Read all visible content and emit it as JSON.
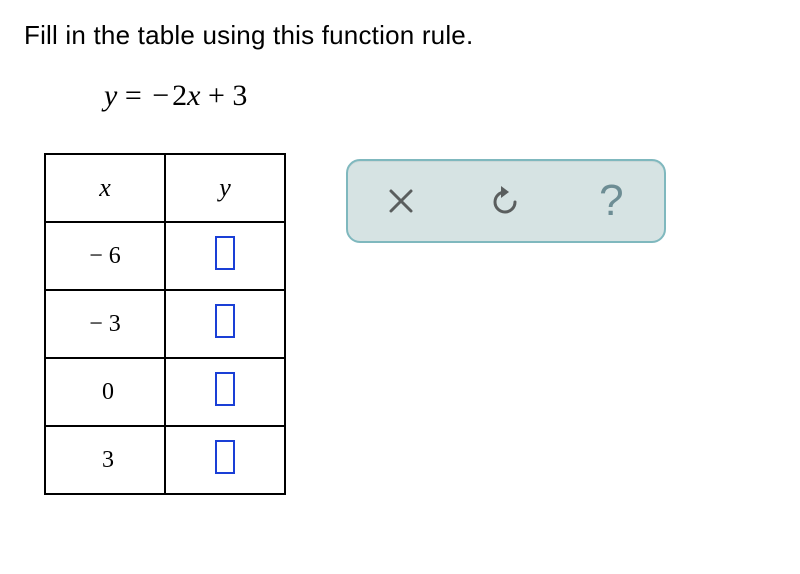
{
  "instruction": "Fill in the table using this function rule.",
  "formula": {
    "lhs": "y",
    "equals": "=",
    "coef_sign": "−",
    "coef": "2",
    "var": "x",
    "op": "+",
    "const": "3"
  },
  "table": {
    "header_x": "x",
    "header_y": "y",
    "rows": [
      {
        "x_sign": "−",
        "x_val": "6",
        "y": ""
      },
      {
        "x_sign": "−",
        "x_val": "3",
        "y": ""
      },
      {
        "x_sign": "",
        "x_val": "0",
        "y": ""
      },
      {
        "x_sign": "",
        "x_val": "3",
        "y": ""
      }
    ]
  },
  "toolbar": {
    "close_label": "close",
    "undo_label": "undo",
    "help_label": "help",
    "help_glyph": "?"
  }
}
